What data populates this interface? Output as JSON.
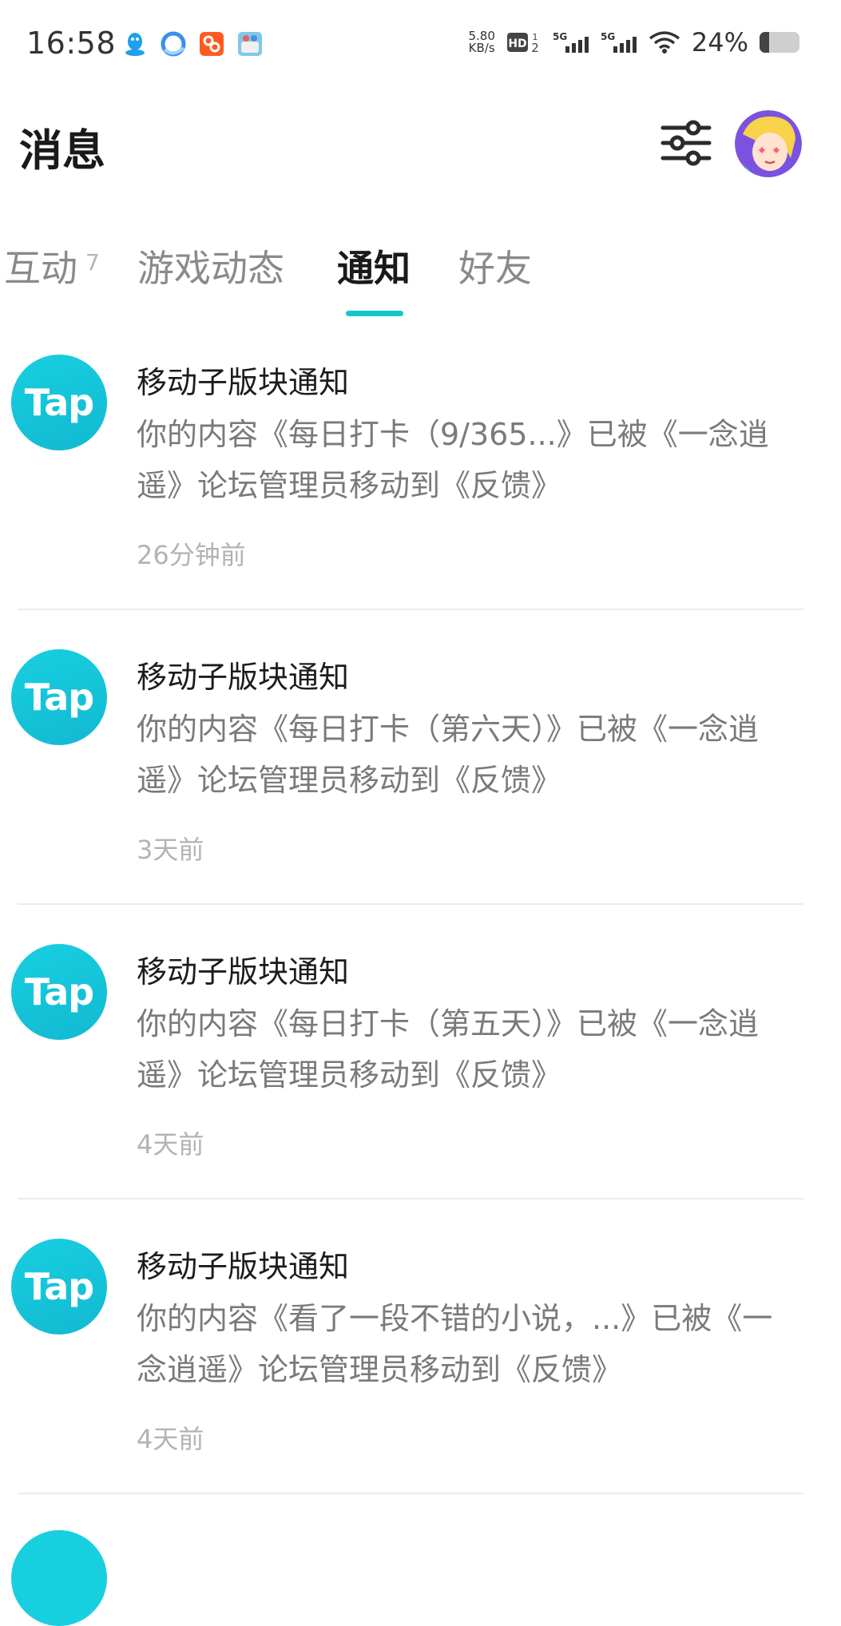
{
  "status_bar": {
    "time": "16:58",
    "net_speed_value": "5.80",
    "net_speed_unit": "KB/s",
    "hd_label": "HD",
    "sim1_label": "5G",
    "sim2_label": "5G",
    "battery_percent": "24%",
    "battery_level": 0.24,
    "notification_icons": [
      "qq-icon",
      "browser-icon",
      "app-store-icon",
      "game-icon"
    ]
  },
  "header": {
    "title": "消息",
    "filter_icon": "sliders-icon",
    "avatar_icon": "user-avatar"
  },
  "tabs": [
    {
      "label": "互动",
      "count": "7",
      "active": false
    },
    {
      "label": "游戏动态",
      "count": "",
      "active": false
    },
    {
      "label": "通知",
      "count": "",
      "active": true
    },
    {
      "label": "好友",
      "count": "",
      "active": false
    }
  ],
  "notifications": [
    {
      "avatar_text": "Tap",
      "title": "移动子版块通知",
      "body": "你的内容《每日打卡（9/365...》已被《一念逍遥》论坛管理员移动到《反馈》",
      "time": "26分钟前"
    },
    {
      "avatar_text": "Tap",
      "title": "移动子版块通知",
      "body": "你的内容《每日打卡（第六天）》已被《一念逍遥》论坛管理员移动到《反馈》",
      "time": "3天前"
    },
    {
      "avatar_text": "Tap",
      "title": "移动子版块通知",
      "body": "你的内容《每日打卡（第五天）》已被《一念逍遥》论坛管理员移动到《反馈》",
      "time": "4天前"
    },
    {
      "avatar_text": "Tap",
      "title": "移动子版块通知",
      "body": "你的内容《看了一段不错的小说，...》已被《一念逍遥》论坛管理员移动到《反馈》",
      "time": "4天前"
    }
  ],
  "colors": {
    "accent": "#15c5ce",
    "tap_brand": "#18cfe0",
    "title_text": "#1a1a1a",
    "secondary_text": "#7a7a7a",
    "timestamp_text": "#b3b3b3"
  }
}
